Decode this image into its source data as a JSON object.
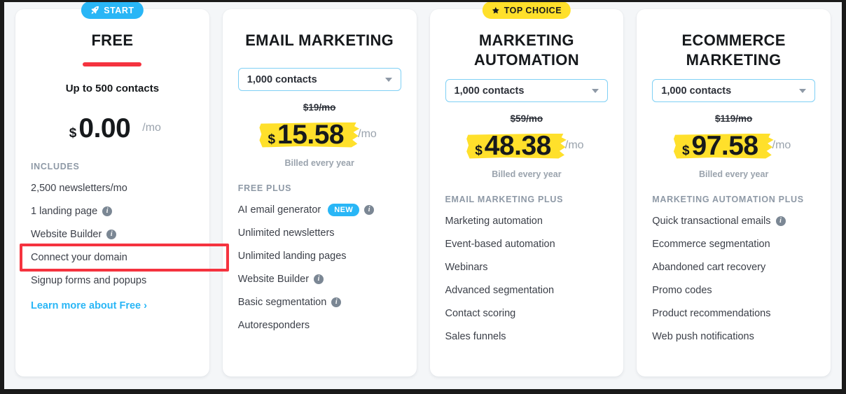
{
  "theme": {
    "accent_blue": "#29b6f6",
    "highlight_yellow": "#ffe02b",
    "annotation_red": "#f5333f",
    "page_background": "#f4f6f8"
  },
  "plans": [
    {
      "badge": {
        "label": "START",
        "icon": "rocket-icon",
        "style": "start"
      },
      "title": "FREE",
      "underline": true,
      "contacts_static": "Up to 500 contacts",
      "old_price": null,
      "currency": "$",
      "price": "0.00",
      "per": "/mo",
      "highlight": false,
      "billed_note": null,
      "features_heading": "INCLUDES",
      "features": [
        {
          "text": "2,500 newsletters/mo",
          "info": false,
          "new": false
        },
        {
          "text": "1 landing page",
          "info": true,
          "new": false
        },
        {
          "text": "Website Builder",
          "info": true,
          "new": false
        },
        {
          "text": "Connect your domain",
          "info": false,
          "new": false,
          "annotated": true
        },
        {
          "text": "Signup forms and popups",
          "info": false,
          "new": false
        }
      ],
      "learn_more": "Learn more about Free ›"
    },
    {
      "badge": null,
      "title": "EMAIL MARKETING",
      "underline": false,
      "select_value": "1,000 contacts",
      "old_price": "$19/mo",
      "currency": "$",
      "price": "15.58",
      "per": "/mo",
      "highlight": true,
      "billed_note": "Billed every year",
      "features_heading": "FREE PLUS",
      "features": [
        {
          "text": "AI email generator",
          "info": true,
          "new": true,
          "new_label": "NEW"
        },
        {
          "text": "Unlimited newsletters",
          "info": false,
          "new": false
        },
        {
          "text": "Unlimited landing pages",
          "info": false,
          "new": false
        },
        {
          "text": "Website Builder",
          "info": true,
          "new": false
        },
        {
          "text": "Basic segmentation",
          "info": true,
          "new": false
        },
        {
          "text": "Autoresponders",
          "info": false,
          "new": false
        }
      ],
      "learn_more": null
    },
    {
      "badge": {
        "label": "TOP CHOICE",
        "icon": "star-icon",
        "style": "top"
      },
      "title": "MARKETING AUTOMATION",
      "underline": false,
      "select_value": "1,000 contacts",
      "old_price": "$59/mo",
      "currency": "$",
      "price": "48.38",
      "per": "/mo",
      "highlight": true,
      "billed_note": "Billed every year",
      "features_heading": "EMAIL MARKETING PLUS",
      "features": [
        {
          "text": "Marketing automation",
          "info": false,
          "new": false
        },
        {
          "text": "Event-based automation",
          "info": false,
          "new": false
        },
        {
          "text": "Webinars",
          "info": false,
          "new": false
        },
        {
          "text": "Advanced segmentation",
          "info": false,
          "new": false
        },
        {
          "text": "Contact scoring",
          "info": false,
          "new": false
        },
        {
          "text": "Sales funnels",
          "info": false,
          "new": false
        }
      ],
      "learn_more": null
    },
    {
      "badge": null,
      "title": "ECOMMERCE MARKETING",
      "underline": false,
      "select_value": "1,000 contacts",
      "old_price": "$119/mo",
      "currency": "$",
      "price": "97.58",
      "per": "/mo",
      "highlight": true,
      "billed_note": "Billed every year",
      "features_heading": "MARKETING AUTOMATION PLUS",
      "features": [
        {
          "text": "Quick transactional emails",
          "info": true,
          "new": false
        },
        {
          "text": "Ecommerce segmentation",
          "info": false,
          "new": false
        },
        {
          "text": "Abandoned cart recovery",
          "info": false,
          "new": false
        },
        {
          "text": "Promo codes",
          "info": false,
          "new": false
        },
        {
          "text": "Product recommendations",
          "info": false,
          "new": false
        },
        {
          "text": "Web push notifications",
          "info": false,
          "new": false
        }
      ],
      "learn_more": null
    }
  ]
}
